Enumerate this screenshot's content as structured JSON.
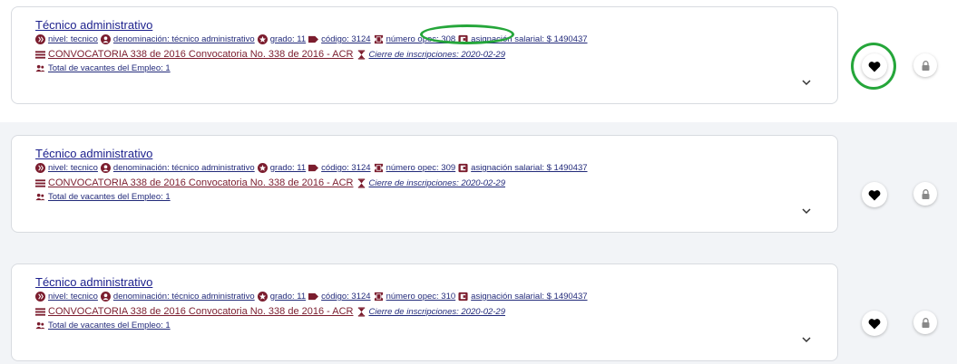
{
  "icons": {
    "nivel": "level-icon",
    "denominacion": "user-icon",
    "grado": "star-badge-icon",
    "codigo": "tag-icon",
    "opec": "ticket-icon",
    "asignacion": "wallet-icon",
    "convocatoria": "list-icon",
    "cierre": "hourglass-icon",
    "vacantes": "users-icon",
    "expand": "chevron-down-icon",
    "favorite": "heart-icon",
    "lock": "lock-icon"
  },
  "colors": {
    "accent_maroon": "#7b1d2e",
    "link_blue": "#222a7a",
    "title_blue": "#1b1f8c",
    "highlight_green": "#25a63a"
  },
  "jobs": [
    {
      "title": "Técnico administrativo",
      "nivel": "nivel: tecnico",
      "denominacion": "denominación: técnico administrativo",
      "grado": "grado: 11",
      "codigo": "código: 3124",
      "opec": "número opec: 308",
      "asignacion": "asignación salarial: $ 1490437",
      "convocatoria": "CONVOCATORIA 338 de 2016 Convocatoria No. 338 de 2016 - ACR",
      "cierre": "Cierre de inscripciones: 2020-02-29",
      "vacantes": "Total de vacantes del Empleo: 1"
    },
    {
      "title": "Técnico administrativo",
      "nivel": "nivel: tecnico",
      "denominacion": "denominación: técnico administrativo",
      "grado": "grado: 11",
      "codigo": "código: 3124",
      "opec": "número opec: 309",
      "asignacion": "asignación salarial: $ 1490437",
      "convocatoria": "CONVOCATORIA 338 de 2016 Convocatoria No. 338 de 2016 - ACR",
      "cierre": "Cierre de inscripciones: 2020-02-29",
      "vacantes": "Total de vacantes del Empleo: 1"
    },
    {
      "title": "Técnico administrativo",
      "nivel": "nivel: tecnico",
      "denominacion": "denominación: técnico administrativo",
      "grado": "grado: 11",
      "codigo": "código: 3124",
      "opec": "número opec: 310",
      "asignacion": "asignación salarial: $ 1490437",
      "convocatoria": "CONVOCATORIA 338 de 2016 Convocatoria No. 338 de 2016 - ACR",
      "cierre": "Cierre de inscripciones: 2020-02-29",
      "vacantes": "Total de vacantes del Empleo: 1"
    }
  ]
}
